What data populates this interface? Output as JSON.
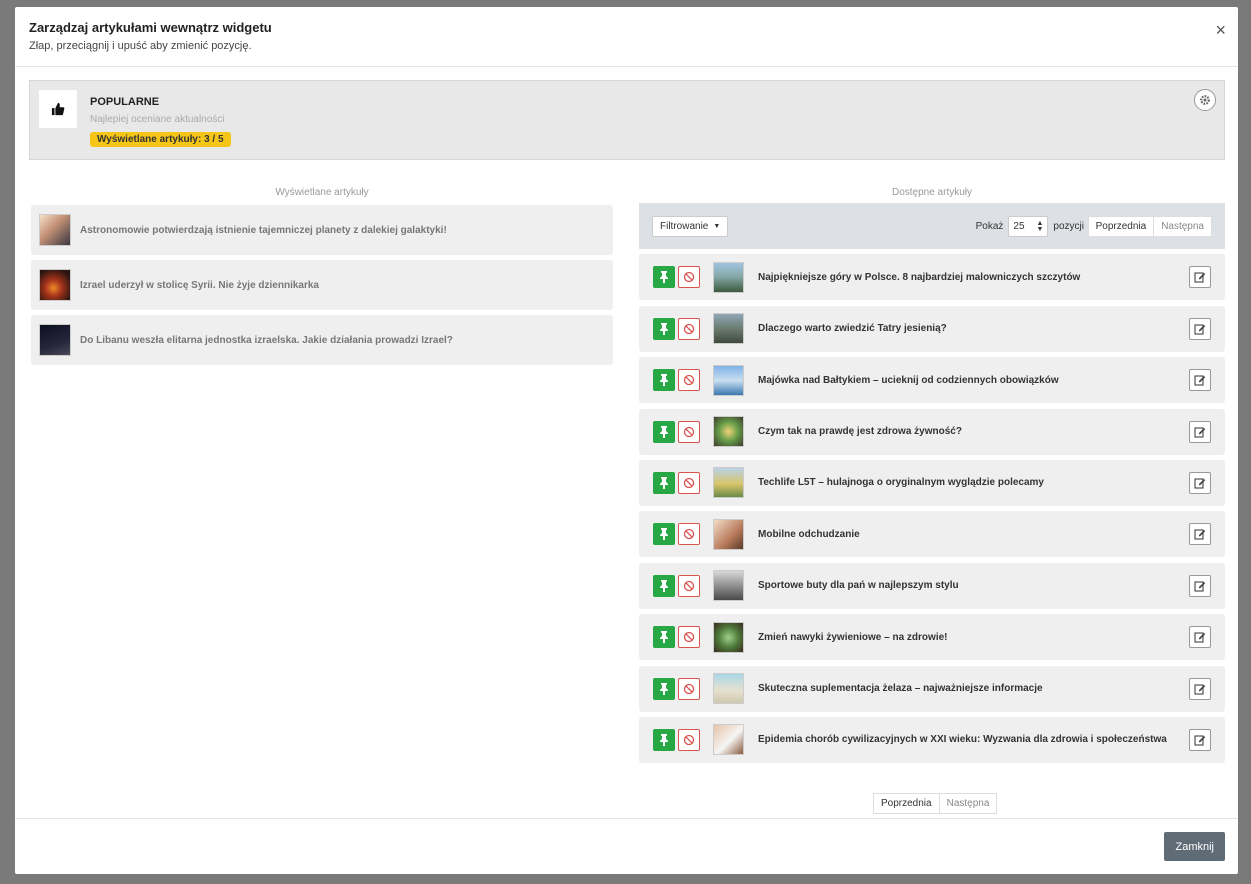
{
  "modal": {
    "title": "Zarządzaj artykułami wewnątrz widgetu",
    "subtitle": "Złap, przeciągnij i upuść aby zmienić pozycję.",
    "close_symbol": "×"
  },
  "widget": {
    "name": "POPULARNE",
    "description": "Najlepiej oceniane aktualności",
    "badge": "Wyświetlane artykuły: 3 / 5",
    "icon": "thumbs-up-icon"
  },
  "left_column": {
    "title": "Wyświetlane artykuły",
    "items": [
      {
        "title": "Astronomowie potwierdzają istnienie tajemniczej planety z dalekiej galaktyki!"
      },
      {
        "title": "Izrael uderzył w stolicę Syrii. Nie żyje dziennikarka"
      },
      {
        "title": "Do Libanu weszła elitarna jednostka izraelska. Jakie działania prowadzi Izrael?"
      }
    ]
  },
  "right_column": {
    "title": "Dostępne artykuły",
    "filter_label": "Filtrowanie",
    "show_label": "Pokaż",
    "per_page": "25",
    "positions_label": "pozycji",
    "prev_label": "Poprzednia",
    "next_label": "Następna",
    "items": [
      {
        "title": "Najpiękniejsze góry w Polsce. 8 najbardziej malowniczych szczytów"
      },
      {
        "title": "Dlaczego warto zwiedzić Tatry jesienią?"
      },
      {
        "title": "Majówka nad Bałtykiem – ucieknij od codziennych obowiązków"
      },
      {
        "title": "Czym tak na prawdę jest zdrowa żywność?"
      },
      {
        "title": "Techlife L5T – hulajnoga o oryginalnym wyglądzie polecamy"
      },
      {
        "title": "Mobilne odchudzanie"
      },
      {
        "title": "Sportowe buty dla pań w najlepszym stylu"
      },
      {
        "title": "Zmień nawyki żywieniowe – na zdrowie!"
      },
      {
        "title": "Skuteczna suplementacja żelaza – najważniejsze informacje"
      },
      {
        "title": "Epidemia chorób cywilizacyjnych w XXI wieku: Wyzwania dla zdrowia i społeczeństwa"
      }
    ]
  },
  "footer": {
    "close_label": "Zamknij"
  },
  "colors": {
    "pin_green": "#28a745",
    "ban_red": "#d9534f",
    "badge_yellow": "#f5c518",
    "close_button": "#5f6b75"
  }
}
